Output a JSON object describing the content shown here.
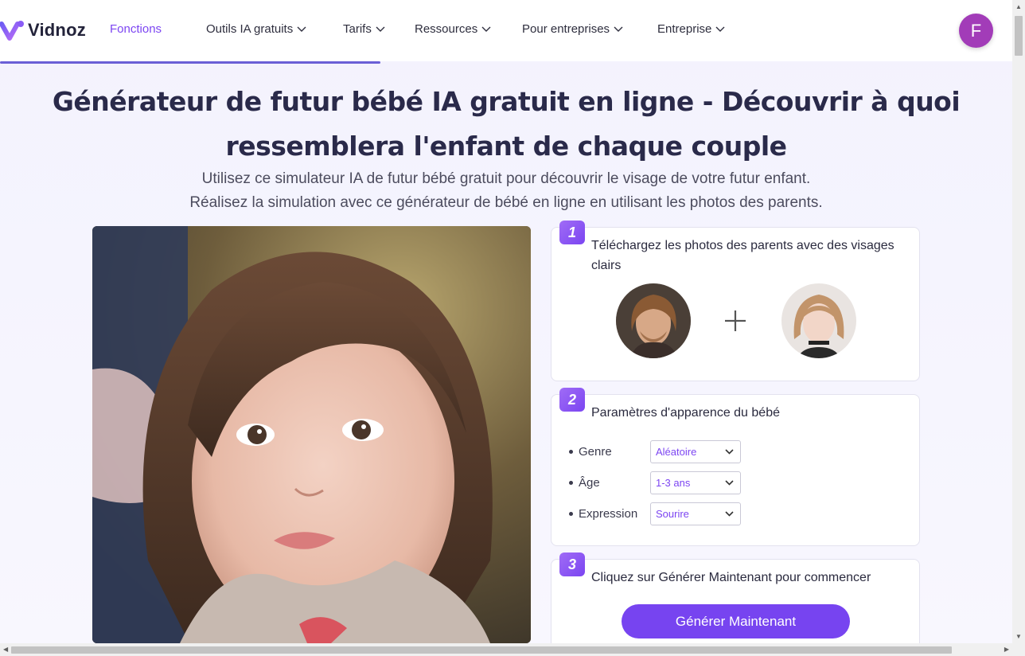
{
  "header": {
    "logo_text": "Vidnoz",
    "nav": [
      {
        "label": "Fonctions",
        "has_menu": false,
        "active": true
      },
      {
        "label": "Outils IA gratuits",
        "has_menu": true,
        "active": false
      },
      {
        "label": "Tarifs",
        "has_menu": true,
        "active": false
      },
      {
        "label": "Ressources",
        "has_menu": true,
        "active": false
      },
      {
        "label": "Pour entreprises",
        "has_menu": true,
        "active": false
      },
      {
        "label": "Entreprise",
        "has_menu": true,
        "active": false
      }
    ],
    "avatar_initial": "F",
    "avatar_color": "#a23cb8"
  },
  "hero": {
    "title_line1": "Générateur de futur bébé IA gratuit en ligne - Découvrir à quoi",
    "title_line2": "ressemblera l'enfant de chaque couple",
    "subtitle_line1": "Utilisez ce simulateur IA de futur bébé gratuit pour découvrir le visage de votre futur enfant.",
    "subtitle_line2": "Réalisez la simulation avec ce générateur de bébé en ligne en utilisant les photos des parents."
  },
  "steps": {
    "step1": {
      "number": "1",
      "title": "Téléchargez les photos des parents avec des visages clairs"
    },
    "step2": {
      "number": "2",
      "title": "Paramètres d'apparence du bébé",
      "options": [
        {
          "label": "Genre",
          "value": "Aléatoire"
        },
        {
          "label": "Âge",
          "value": "1-3 ans"
        },
        {
          "label": "Expression",
          "value": "Sourire"
        }
      ]
    },
    "step3": {
      "number": "3",
      "title": "Cliquez sur Générer Maintenant pour commencer",
      "button_label": "Générer Maintenant"
    }
  },
  "colors": {
    "accent": "#7744f0",
    "accent_text": "#7c45f2",
    "title": "#2a2a4a"
  }
}
